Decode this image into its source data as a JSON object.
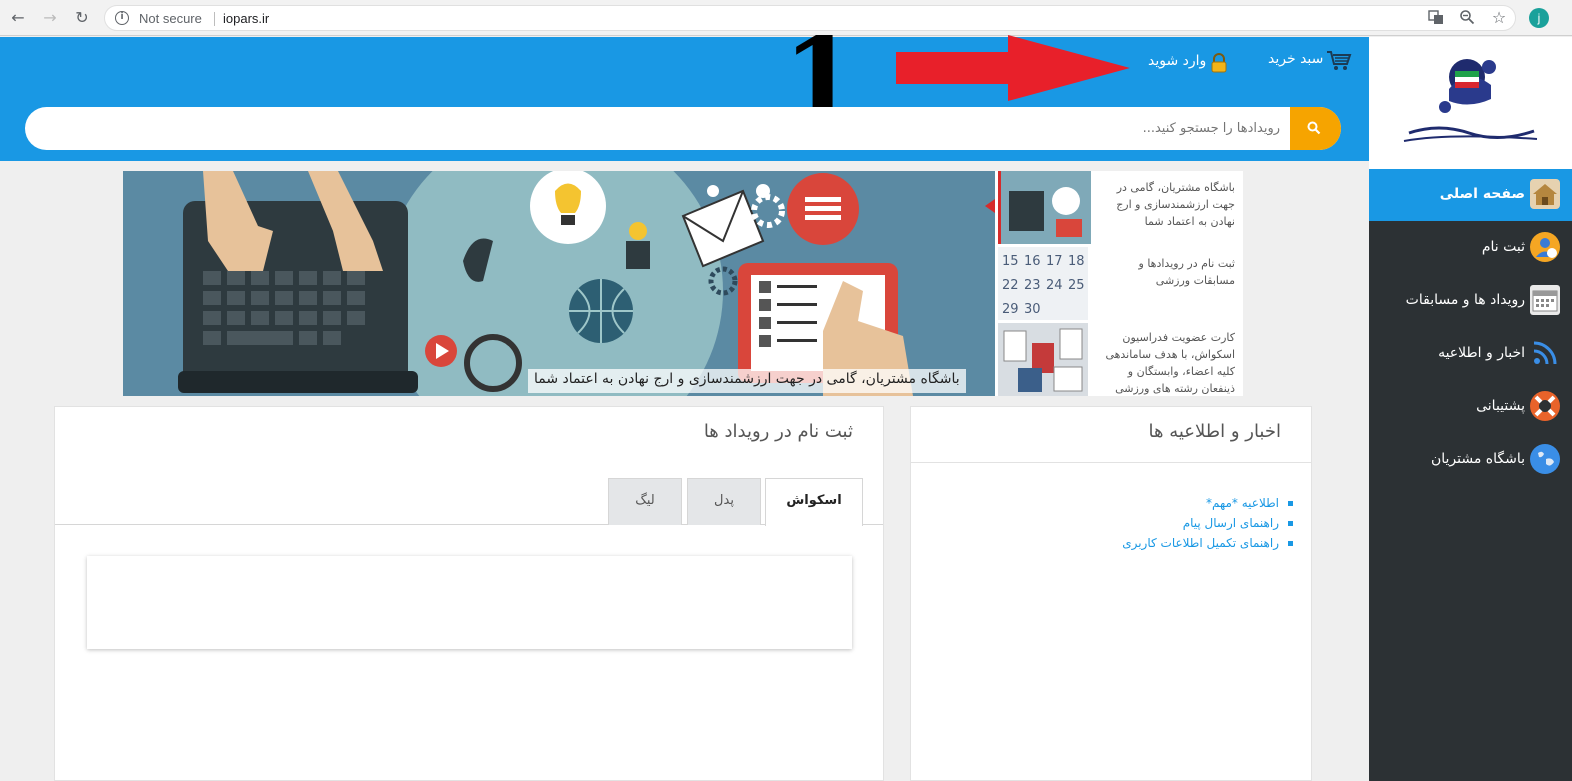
{
  "browser": {
    "security_label": "Not secure",
    "url": "iopars.ir",
    "avatar_letter": "j"
  },
  "header": {
    "cart_label": "سبد خرید",
    "login_label": "وارد شوید",
    "annotation_number": "1",
    "search_placeholder": "رویدادها را جستجو کنید..."
  },
  "sidebar": {
    "items": [
      {
        "label": "صفحه اصلی"
      },
      {
        "label": "ثبت نام"
      },
      {
        "label": "رویداد ها و مسابقات"
      },
      {
        "label": "اخبار و اطلاعیه"
      },
      {
        "label": "پشتیبانی"
      },
      {
        "label": "باشگاه مشتریان"
      }
    ]
  },
  "slider": {
    "caption": "باشگاه مشتریان، گامی در جهت ارزشمندسازی و ارج نهادن به اعتماد شما",
    "thumbs": [
      {
        "text": "باشگاه مشتریان، گامی در جهت ارزشمندسازی و ارج نهادن به اعتماد شما"
      },
      {
        "text": "ثبت نام در رویدادها و مسابقات ورزشی"
      },
      {
        "text": "کارت عضویت فدراسیون اسکواش، با هدف ساماندهی کلیه اعضاء، وابستگان و ذینفعان رشته های ورزشی"
      }
    ]
  },
  "news_panel": {
    "title": "اخبار و اطلاعیه ها",
    "items": [
      "اطلاعیه *مهم*",
      "راهنمای ارسال پیام",
      "راهنمای تکمیل اطلاعات کاربری"
    ]
  },
  "registration_panel": {
    "title": "ثبت نام در رویداد ها",
    "tabs": [
      {
        "label": "اسکواش",
        "active": true
      },
      {
        "label": "پدل",
        "active": false
      },
      {
        "label": "لیگ",
        "active": false
      }
    ]
  },
  "colors": {
    "header_blue": "#1998e4",
    "search_button": "#f6a400",
    "sidebar_bg": "#2c3134",
    "annotation_arrow": "#e8202a"
  }
}
